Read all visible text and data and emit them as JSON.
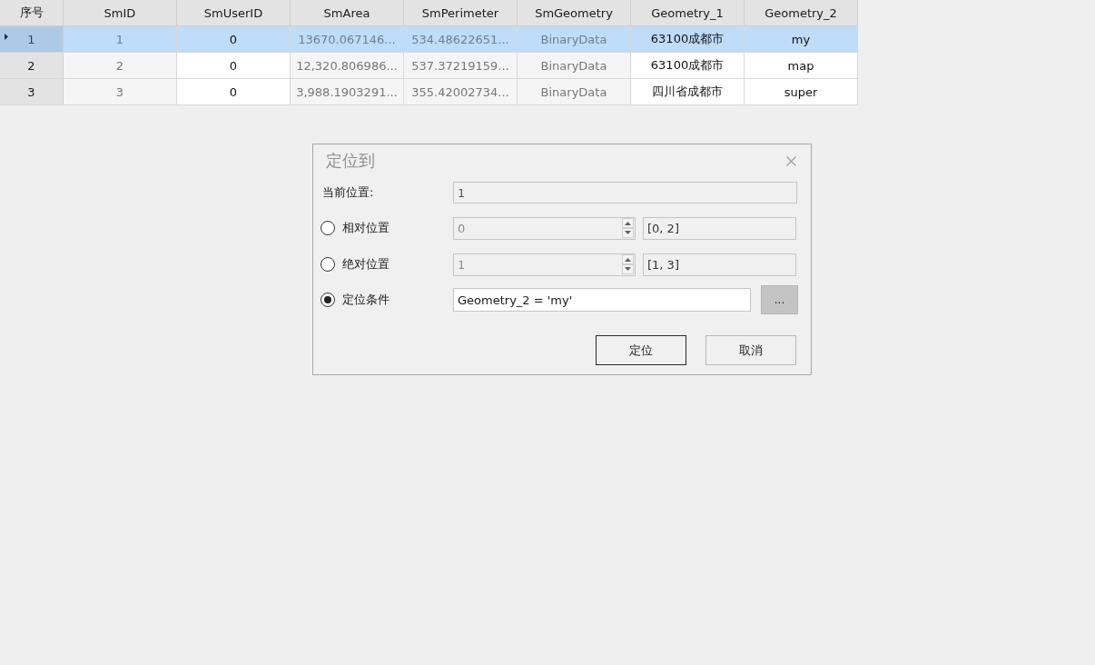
{
  "table": {
    "row_header": "序号",
    "columns": [
      {
        "label": "SmID",
        "kind": "readonly"
      },
      {
        "label": "SmUserID",
        "kind": "editable"
      },
      {
        "label": "SmArea",
        "kind": "readonly"
      },
      {
        "label": "SmPerimeter",
        "kind": "readonly"
      },
      {
        "label": "SmGeometry",
        "kind": "readonly"
      },
      {
        "label": "Geometry_1",
        "kind": "editable"
      },
      {
        "label": "Geometry_2",
        "kind": "editable"
      }
    ],
    "rows": [
      {
        "number": "1",
        "selected": true,
        "cells": [
          "1",
          "0",
          "13670.067146...",
          "534.48622651...",
          "BinaryData",
          "63100成都市",
          "my"
        ]
      },
      {
        "number": "2",
        "selected": false,
        "cells": [
          "2",
          "0",
          "12,320.806986...",
          "537.37219159...",
          "BinaryData",
          "63100成都市",
          "map"
        ]
      },
      {
        "number": "3",
        "selected": false,
        "cells": [
          "3",
          "0",
          "3,988.1903291...",
          "355.42002734...",
          "BinaryData",
          "四川省成都市",
          "super"
        ]
      }
    ]
  },
  "dialog": {
    "title": "定位到",
    "current_position": {
      "label": "当前位置:",
      "value": "1"
    },
    "options": [
      {
        "kind": "spin",
        "label": "相对位置",
        "selected": false,
        "value": "0",
        "range": "[0, 2]"
      },
      {
        "kind": "spin",
        "label": "绝对位置",
        "selected": false,
        "value": "1",
        "range": "[1, 3]"
      },
      {
        "kind": "condition",
        "label": "定位条件",
        "selected": true,
        "value": "Geometry_2 = 'my'",
        "button": "..."
      }
    ],
    "buttons": [
      {
        "label": "定位",
        "default": true
      },
      {
        "label": "取消",
        "default": false
      }
    ]
  }
}
